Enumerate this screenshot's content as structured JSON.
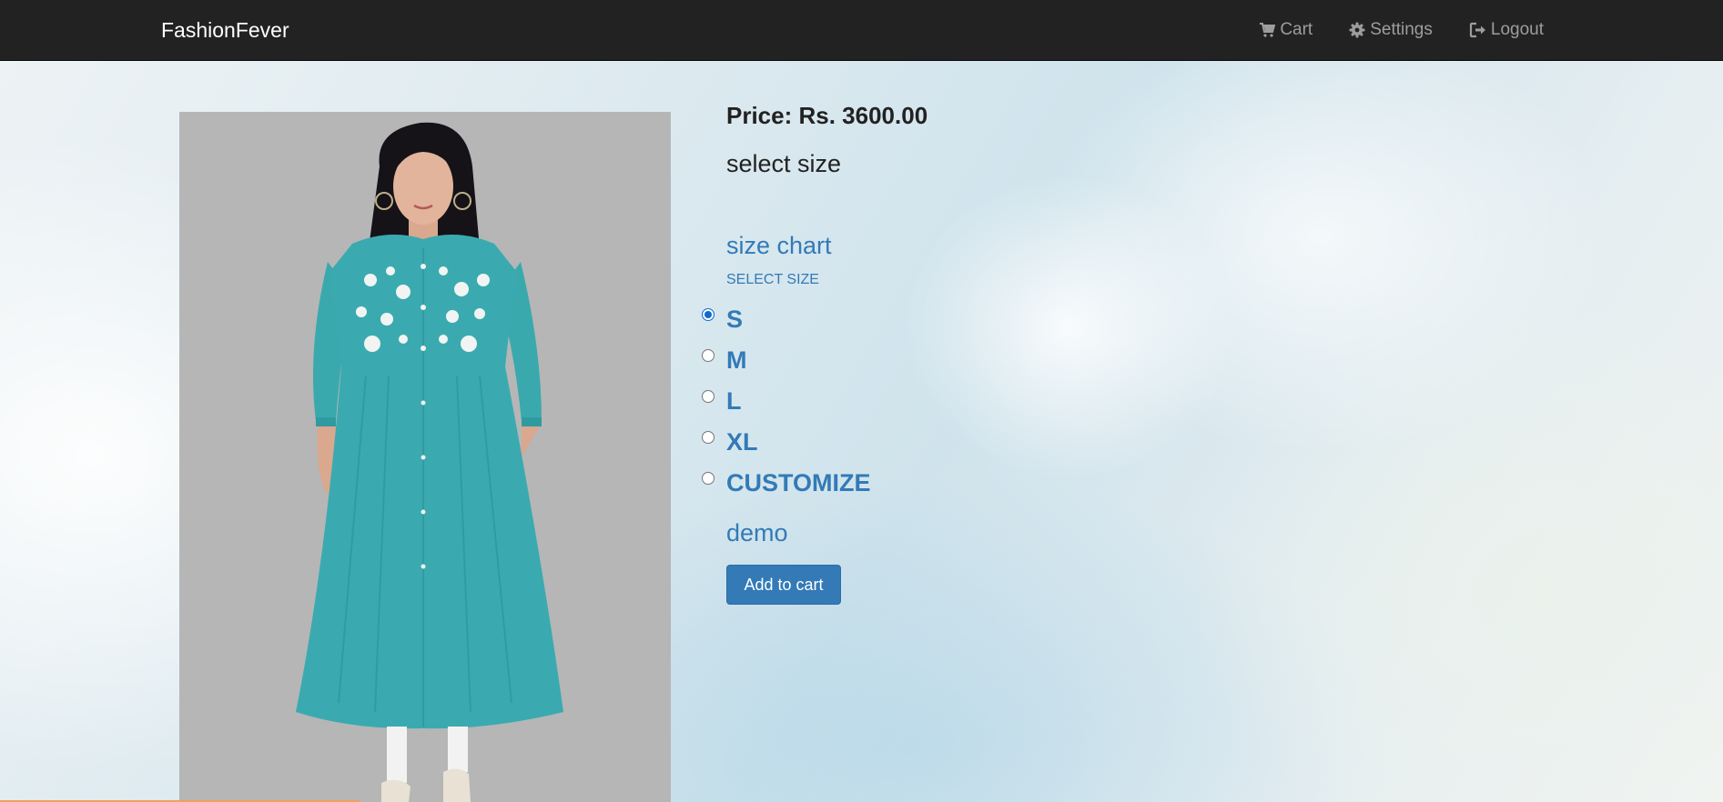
{
  "navbar": {
    "brand": "FashionFever",
    "links": [
      {
        "label": "Cart",
        "icon": "shopping-cart-icon"
      },
      {
        "label": "Settings",
        "icon": "gear-icon"
      },
      {
        "label": "Logout",
        "icon": "logout-icon"
      }
    ]
  },
  "product": {
    "price": "Price: Rs. 3600.00",
    "select_size_heading": "select size",
    "size_chart_link": "size chart",
    "select_size_label": "SELECT SIZE",
    "sizes": [
      {
        "label": "S",
        "selected": true
      },
      {
        "label": "M",
        "selected": false
      },
      {
        "label": "L",
        "selected": false
      },
      {
        "label": "XL",
        "selected": false
      },
      {
        "label": "CUSTOMIZE",
        "selected": false
      }
    ],
    "description": "demo",
    "add_to_cart_label": "Add to cart"
  },
  "colors": {
    "navbar_bg": "#222222",
    "link_blue": "#337ab7",
    "kurta_teal": "#3aaab0",
    "image_bg": "#b6b6b6"
  }
}
